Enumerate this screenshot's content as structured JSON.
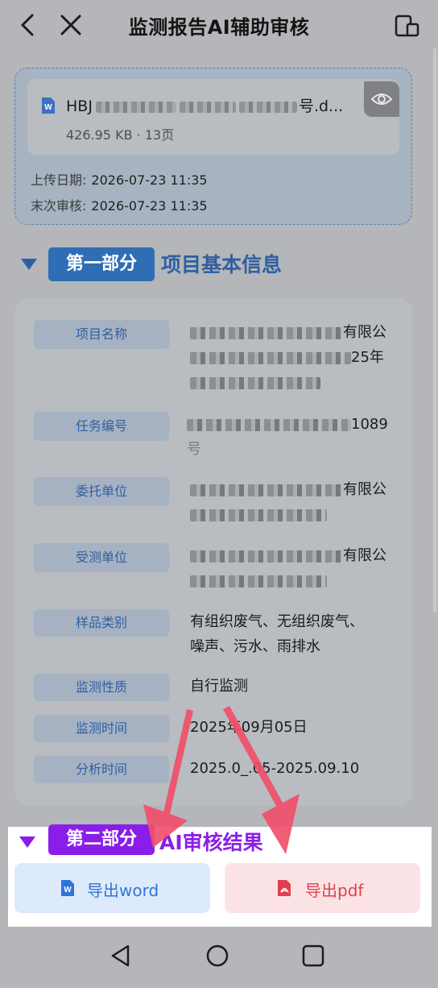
{
  "header": {
    "title": "监测报告AI辅助审核",
    "back_icon": "chevron-left-icon",
    "close_icon": "close-icon",
    "device_icon": "device-switch-icon"
  },
  "file": {
    "name_start": "HBJ",
    "name_end": "号.d...",
    "size": "426.95 KB",
    "separator": "·",
    "pages": "13页",
    "upload_label": "上传日期:",
    "upload_date": "2026-07-23 11:35",
    "review_label": "末次审核:",
    "review_date": "2026-07-23 11:35"
  },
  "section1": {
    "badge": "第一部分",
    "title": "项目基本信息"
  },
  "fields": [
    {
      "label": "项目名称",
      "line1_end": "有限公",
      "line2_end": "25年"
    },
    {
      "label": "任务编号",
      "line1_end": "1089",
      "line2": "号"
    },
    {
      "label": "委托单位",
      "line1_end": "有限公"
    },
    {
      "label": "受测单位",
      "line1_end": "有限公"
    },
    {
      "label": "样品类别",
      "line1": "有组织废气、无组织废气、",
      "line2": "噪声、污水、雨排水"
    },
    {
      "label": "监测性质",
      "line1": "自行监测"
    },
    {
      "label": "监测时间",
      "line1": "2025年09月05日"
    },
    {
      "label": "分析时间",
      "line1": "2025.0_.05-2025.09.10"
    }
  ],
  "section2": {
    "badge": "第二部分",
    "title": "AI审核结果"
  },
  "export": {
    "word_label": "导出word",
    "pdf_label": "导出pdf"
  },
  "colors": {
    "accent_blue": "#2f5fa3",
    "section2_purple": "#8a1ee8",
    "pdf_red": "#e0404e",
    "arrow_red": "#f0506a"
  }
}
